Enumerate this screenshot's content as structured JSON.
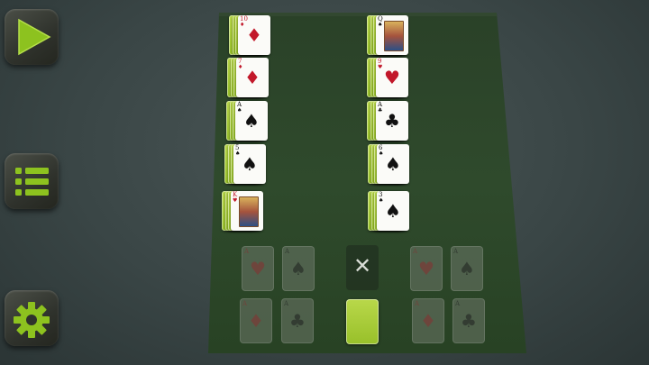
{
  "sidebar": {
    "buttons": [
      {
        "id": "play",
        "icon": "play-icon"
      },
      {
        "id": "menu",
        "icon": "list-icon"
      },
      {
        "id": "settings",
        "icon": "gear-icon"
      }
    ]
  },
  "colors": {
    "accent": "#8dc21f",
    "felt": "#2e4a2e",
    "card_back": "#a7cc35",
    "red_suit": "#c2182a"
  },
  "tableau": {
    "left": [
      {
        "rank": "10",
        "suit": "♦",
        "red": true
      },
      {
        "rank": "7",
        "suit": "♦",
        "red": true
      },
      {
        "rank": "A",
        "suit": "♠",
        "red": false
      },
      {
        "rank": "5",
        "suit": "♠",
        "red": false
      },
      {
        "rank": "K",
        "suit": "♥",
        "red": true
      }
    ],
    "right": [
      {
        "rank": "Q",
        "suit": "♠",
        "red": false
      },
      {
        "rank": "9",
        "suit": "♥",
        "red": true
      },
      {
        "rank": "A",
        "suit": "♣",
        "red": false
      },
      {
        "rank": "6",
        "suit": "♠",
        "red": false
      },
      {
        "rank": "3",
        "suit": "♠",
        "red": false
      }
    ]
  },
  "foundations": [
    {
      "rank": "A",
      "suit": "♥",
      "red": true
    },
    {
      "rank": "A",
      "suit": "♠",
      "red": false
    },
    {
      "rank": "A",
      "suit": "♦",
      "red": true
    },
    {
      "rank": "A",
      "suit": "♣",
      "red": false
    },
    {
      "rank": "A",
      "suit": "♥",
      "red": true
    },
    {
      "rank": "A",
      "suit": "♠",
      "red": false
    },
    {
      "rank": "A",
      "suit": "♦",
      "red": true
    },
    {
      "rank": "A",
      "suit": "♣",
      "red": false
    }
  ],
  "waste": {
    "mark": "✕"
  }
}
